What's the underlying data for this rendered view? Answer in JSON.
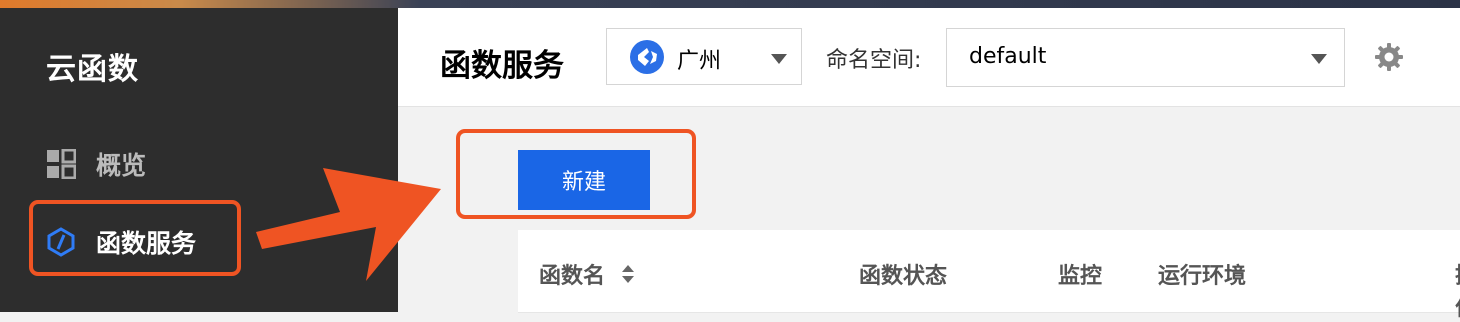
{
  "sidebar": {
    "title": "云函数",
    "items": [
      {
        "label": "概览",
        "icon": "grid-icon"
      },
      {
        "label": "函数服务",
        "icon": "hexagon-icon"
      }
    ]
  },
  "header": {
    "title": "函数服务",
    "region": {
      "value": "广州",
      "icon": "region-icon"
    },
    "namespace": {
      "label": "命名空间:",
      "value": "default"
    },
    "settings_icon": "gear-icon"
  },
  "toolbar": {
    "new_label": "新建"
  },
  "table": {
    "columns": [
      "函数名",
      "函数状态",
      "监控",
      "运行环境",
      "操作"
    ]
  },
  "colors": {
    "sidebar_bg": "#2d2d2d",
    "primary_button": "#1a66e6",
    "annotation": "#ef5423"
  }
}
